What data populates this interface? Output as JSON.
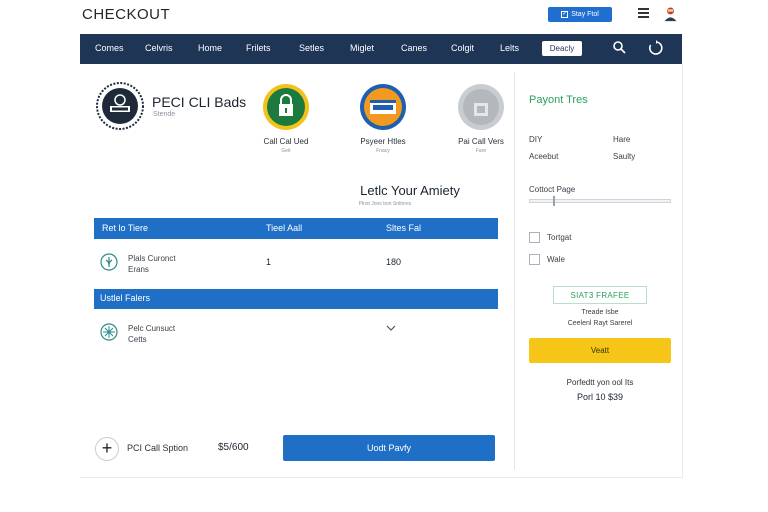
{
  "header": {
    "brand": "CHECKOUT",
    "top_button": "Stay Ftol",
    "menu_icon": "hamburger-icon",
    "avatar_icon": "user-avatar-icon"
  },
  "nav": {
    "items": [
      "Comes",
      "Celvris",
      "Home",
      "Frilets",
      "Setles",
      "Miglet",
      "Canes",
      "Colgit",
      "Lelts"
    ],
    "active": "Deacly",
    "search_icon": "search-icon",
    "refresh_icon": "refresh-icon"
  },
  "pci": {
    "title": "PECI CLI Bads",
    "subtitle": "Stende"
  },
  "badges": [
    {
      "label": "Call Cal Ued",
      "sub": "Geit",
      "icon": "lock-badge-icon",
      "color": "#1c7a3e"
    },
    {
      "label": "Psyeer Htles",
      "sub": "Fnacy",
      "icon": "visa-badge-icon",
      "color": "#f29a1f"
    },
    {
      "label": "Pai Call Vers",
      "sub": "Fare",
      "icon": "grey-lock-badge-icon",
      "color": "#b8bcc0"
    }
  ],
  "section": {
    "heading": "Letlc Your Amiety",
    "subheading": "Plnst Jons bon Sntinres"
  },
  "table": {
    "headers": [
      "Ret lo Tiere",
      "Tieel Aall",
      "Sltes Fal"
    ],
    "row1": {
      "name": "Plals Curonct",
      "sub": "Erans",
      "qty": "1",
      "price": "180"
    },
    "section_header": "Ustlel Falers",
    "row2": {
      "name": "Pelc Cunsuct",
      "sub": "Cetts"
    }
  },
  "bottom": {
    "label": "PCI Call Sption",
    "price": "$5/600",
    "button": "Uodt Pavfy"
  },
  "sidebar": {
    "title": "Payont Tres",
    "kv": [
      {
        "k": "DIY",
        "v": "Hare"
      },
      {
        "k": "Aceebut",
        "v": "Saulty"
      }
    ],
    "slider_label": "Cottoct Page",
    "slider_value": 0.17,
    "checks": [
      {
        "label": "Tortgat",
        "checked": false
      },
      {
        "label": "Wale",
        "checked": false
      }
    ],
    "stamp": "SIAT3 FRAFEE",
    "note1": "Treade Isbe",
    "note2": "Ceelenl Rayt Sarerel",
    "yellow_button": "Veatt",
    "total_label": "Porfedtt yon ool Its",
    "total_value": "Porl 10 $39"
  },
  "colors": {
    "nav_bg": "#1e3556",
    "primary_blue": "#1f6fc6",
    "accent_green": "#2aa05c",
    "accent_yellow": "#f5c518"
  }
}
